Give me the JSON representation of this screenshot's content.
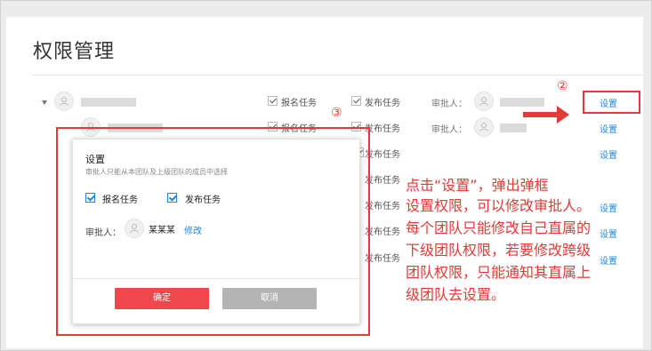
{
  "page": {
    "title": "权限管理"
  },
  "rows": [
    {
      "caret": true,
      "task_register": "报名任务",
      "task_publish": "发布任务",
      "approver_label": "审批人：",
      "action": "设置"
    },
    {
      "caret": false,
      "task_register": "报名任务",
      "task_publish": "发布任务",
      "approver_label": "审批人：",
      "action": "设置"
    },
    {
      "task_publish": "发布任务",
      "action": "设置"
    },
    {
      "task_publish": "发布任务"
    },
    {
      "task_publish": "发布任务",
      "action": "设置"
    },
    {
      "task_publish": "发布任务",
      "action": "设置"
    },
    {
      "task_publish": "发布任务",
      "action": "设置"
    }
  ],
  "dialog": {
    "title": "设置",
    "subtitle": "审批人只能从本团队及上级团队的成员中选择",
    "option_register": "报名任务",
    "option_publish": "发布任务",
    "option_register_checked": true,
    "option_publish_checked": true,
    "approver_label": "审批人：",
    "approver_name": "某某某",
    "modify_link": "修改",
    "confirm_button": "确定",
    "cancel_button": "取消"
  },
  "annotations": {
    "marker_2": "②",
    "marker_3": "③",
    "note_1": "点击“设置”，弹出弹框",
    "note_2": "设置权限，可以修改审批人。",
    "note_3": "每个团队只能修改自己直属的",
    "note_4": "下级团队权限，若要修改跨级",
    "note_5": "团队权限，只能通知其直属上",
    "note_6": "级团队去设置。",
    "color": "#e53935"
  },
  "colors": {
    "accent": "#1e88e5",
    "confirm": "#f0474c",
    "cancel": "#b4b4b4"
  }
}
